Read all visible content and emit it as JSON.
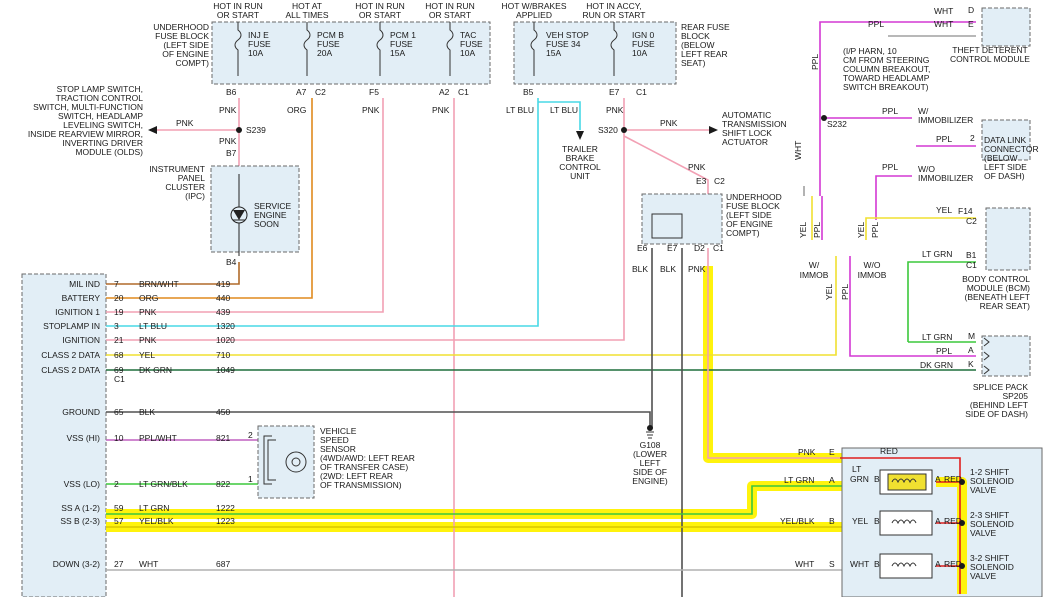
{
  "colors": {
    "pnk": "#f2a0b4",
    "org": "#e08a1e",
    "ltblu": "#48d8e6",
    "yel": "#f0e030",
    "dkgrn": "#1e6e3c",
    "ltgrn": "#3cc83c",
    "blk": "#505050",
    "ppl": "#d438d4",
    "wht": "#a0a0a0",
    "red": "#e01e1e",
    "highlight": "#fff200",
    "box_fill": "#e2eef6"
  },
  "top_labels": {
    "hot1": [
      "HOT IN RUN",
      "OR START"
    ],
    "hot2": [
      "HOT AT",
      "ALL TIMES"
    ],
    "hot3": [
      "HOT IN RUN",
      "OR START"
    ],
    "hot4": [
      "HOT IN RUN",
      "OR START"
    ],
    "hot5": [
      "HOT W/BRAKES",
      "APPLIED"
    ],
    "hot6": [
      "HOT IN ACCY,",
      "RUN OR START"
    ]
  },
  "underhood_fuse_block": {
    "title": [
      "UNDERHOOD",
      "FUSE BLOCK",
      "(LEFT SIDE",
      "OF ENGINE",
      "COMPT)"
    ],
    "fuses": [
      [
        "INJ E",
        "FUSE",
        "10A"
      ],
      [
        "PCM B",
        "FUSE",
        "20A"
      ],
      [
        "PCM 1",
        "FUSE",
        "15A"
      ],
      [
        "TAC",
        "FUSE",
        "10A"
      ]
    ],
    "pins": {
      "b6": "B6",
      "a7": "A7",
      "c2": "C2",
      "f5": "F5",
      "a2": "A2",
      "c1": "C1"
    }
  },
  "rear_fuse_block": {
    "title": [
      "REAR FUSE",
      "BLOCK",
      "(BELOW",
      "LEFT REAR",
      "SEAT)"
    ],
    "fuses": [
      [
        "VEH STOP",
        "FUSE 34",
        "15A"
      ],
      [
        "IGN 0",
        "FUSE",
        "10A"
      ]
    ],
    "pins": {
      "b5": "B5",
      "e7": "E7",
      "c1": "C1"
    }
  },
  "wire_labels": {
    "pnk": "PNK",
    "org": "ORG",
    "ltblu": "LT BLU",
    "blk": "BLK",
    "ppl": "PPL",
    "wht": "WHT",
    "yel": "YEL",
    "ltgrn": "LT GRN",
    "dkgrn": "DK GRN",
    "yelblk": "YEL/BLK",
    "red": "RED",
    "lt": "LT",
    "grn": "GRN"
  },
  "splices": {
    "s239": "S239",
    "s320": "S320",
    "s232": "S232"
  },
  "stop_lamp_switch": [
    "STOP LAMP SWITCH,",
    "TRACTION CONTROL",
    "SWITCH, MULTI-FUNCTION",
    "SWITCH, HEADLAMP",
    "LEVELING SWITCH,",
    "INSIDE REARVIEW MIRROR,",
    "INVERTING DRIVER",
    "MODULE (OLDS)"
  ],
  "ipc": {
    "title": [
      "INSTRUMENT",
      "PANEL",
      "CLUSTER",
      "(IPC)"
    ],
    "lamp": [
      "SERVICE",
      "ENGINE",
      "SOON"
    ],
    "pin_b7": "B7",
    "pin_b4": "B4"
  },
  "trailer_brake": [
    "TRAILER",
    "BRAKE",
    "CONTROL",
    "UNIT"
  ],
  "shift_lock": [
    "AUTOMATIC",
    "TRANSMISSION",
    "SHIFT LOCK",
    "ACTUATOR"
  ],
  "underhood_fuse_block_2": {
    "title": [
      "UNDERHOOD",
      "FUSE BLOCK",
      "(LEFT SIDE",
      "OF ENGINE",
      "COMPT)"
    ],
    "pins": {
      "e3": "E3",
      "c2": "C2",
      "e6": "E6",
      "e7": "E7",
      "d2": "D2",
      "c1": "C1"
    }
  },
  "ip_harness_note": [
    "(I/P HARN, 10",
    "CM FROM STEERING",
    "COLUMN BREAKOUT,",
    "TOWARD HEADLAMP",
    "SWITCH BREAKOUT)"
  ],
  "theft_module": {
    "title": [
      "THEFT DETERENT",
      "CONTROL MODULE"
    ],
    "pin_d": "D",
    "pin_e": "E"
  },
  "immobilizer": {
    "with": [
      "W/",
      "IMMOBILIZER"
    ],
    "without": [
      "W/O",
      "IMMOBILIZER"
    ],
    "w_immob": [
      "W/",
      "IMMOB"
    ],
    "wo_immob": [
      "W/O",
      "IMMOB"
    ]
  },
  "dlc": {
    "title": [
      "DATA LINK",
      "CONNECTOR",
      "(BELOW",
      "LEFT SIDE",
      "OF DASH)"
    ],
    "pin": "2"
  },
  "bcm": {
    "title": [
      "BODY CONTROL",
      "MODULE (BCM)",
      "(BENEATH LEFT",
      "REAR SEAT)"
    ],
    "pins": {
      "f14": "F14",
      "c2": "C2",
      "b1": "B1",
      "c1": "C1"
    }
  },
  "splice_pack": {
    "title": [
      "SPLICE PACK",
      "SP205",
      "(BEHIND LEFT",
      "SIDE OF DASH)"
    ],
    "pins": {
      "m": "M",
      "a": "A",
      "k": "K"
    }
  },
  "pcm_rows": [
    {
      "name": "MIL IND",
      "pin": "7",
      "color": "BRN/WHT",
      "circuit": "419"
    },
    {
      "name": "BATTERY",
      "pin": "20",
      "color": "ORG",
      "circuit": "440"
    },
    {
      "name": "IGNITION 1",
      "pin": "19",
      "color": "PNK",
      "circuit": "439"
    },
    {
      "name": "STOPLAMP IN",
      "pin": "3",
      "color": "LT BLU",
      "circuit": "1320"
    },
    {
      "name": "IGNITION",
      "pin": "21",
      "color": "PNK",
      "circuit": "1020"
    },
    {
      "name": "CLASS 2 DATA",
      "pin": "68",
      "color": "YEL",
      "circuit": "710"
    },
    {
      "name": "CLASS 2 DATA",
      "pin": "69",
      "color": "DK GRN",
      "circuit": "1049"
    },
    {
      "name": "GROUND",
      "pin": "65",
      "color": "BLK",
      "circuit": "450"
    },
    {
      "name": "VSS (HI)",
      "pin": "10",
      "color": "PPL/WHT",
      "circuit": "821"
    },
    {
      "name": "VSS (LO)",
      "pin": "2",
      "color": "LT GRN/BLK",
      "circuit": "822"
    },
    {
      "name": "SS A (1-2)",
      "pin": "59",
      "color": "LT GRN",
      "circuit": "1222"
    },
    {
      "name": "SS B (2-3)",
      "pin": "57",
      "color": "YEL/BLK",
      "circuit": "1223"
    },
    {
      "name": "DOWN (3-2)",
      "pin": "27",
      "color": "WHT",
      "circuit": "687"
    }
  ],
  "pcm_connector": "C1",
  "vss": {
    "title": [
      "VEHICLE",
      "SPEED",
      "SENSOR",
      "(4WD/AWD: LEFT REAR",
      "OF TRANSFER CASE)",
      "(2WD: LEFT REAR",
      "OF TRANSMISSION)"
    ],
    "pin_hi": "2",
    "pin_lo": "1"
  },
  "ground_g108": [
    "G108",
    "(LOWER",
    "LEFT",
    "SIDE OF",
    "ENGINE)"
  ],
  "solenoids": {
    "s12": [
      "1-2 SHIFT",
      "SOLENOID",
      "VALVE"
    ],
    "s23": [
      "2-3 SHIFT",
      "SOLENOID",
      "VALVE"
    ],
    "s32": [
      "3-2 SHIFT",
      "SOLENOID",
      "VALVE"
    ],
    "pin_a": "A",
    "pin_b": "B"
  },
  "trans_pins": {
    "e": "E",
    "a": "A",
    "b": "B",
    "s": "S"
  }
}
